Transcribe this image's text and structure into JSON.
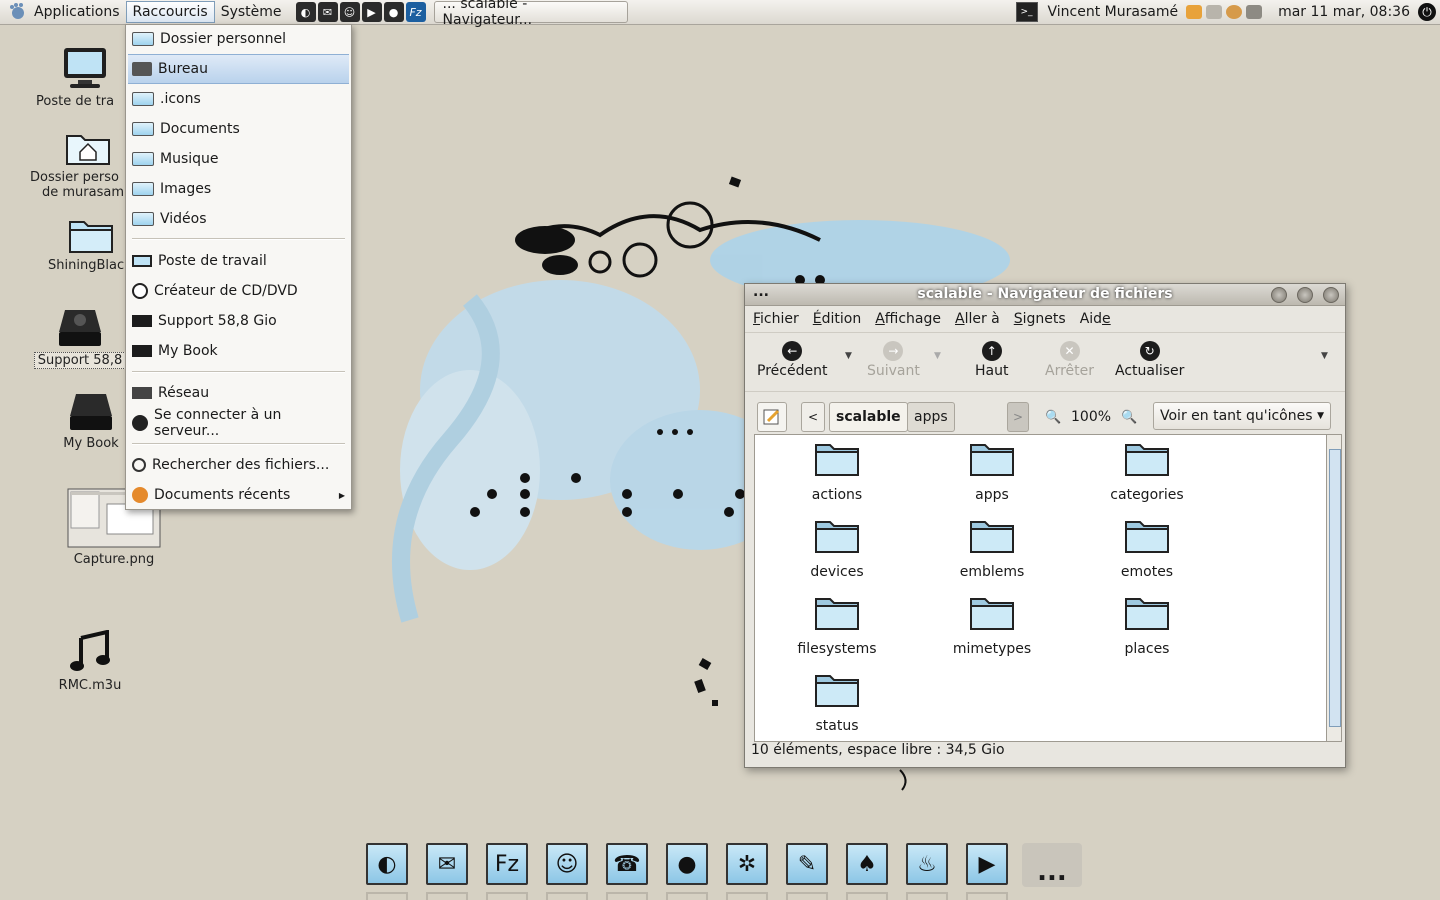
{
  "top_panel": {
    "menus": [
      "Applications",
      "Raccourcis",
      "Système"
    ],
    "task_label": "...  scalable - Navigateur...",
    "user": "Vincent Murasamé",
    "clock": "mar 11 mar, 08:36",
    "launchers": [
      "firefox-icon",
      "mail-icon",
      "people-icon",
      "play-icon",
      "drop-icon",
      "filezilla-icon"
    ],
    "launcher_glyphs": [
      "◐",
      "✉",
      "☺",
      "▶",
      "●",
      "Fz"
    ]
  },
  "places_menu": {
    "items": [
      {
        "label": "Dossier personnel",
        "icon": "home-folder-icon"
      },
      {
        "label": "Bureau",
        "icon": "desktop-folder-icon"
      },
      {
        "label": ".icons",
        "icon": "folder-icon"
      },
      {
        "label": "Documents",
        "icon": "folder-icon"
      },
      {
        "label": "Musique",
        "icon": "folder-icon"
      },
      {
        "label": "Images",
        "icon": "folder-icon"
      },
      {
        "label": "Vidéos",
        "icon": "folder-icon"
      },
      {
        "label": "Poste de travail",
        "icon": "computer-icon"
      },
      {
        "label": "Créateur de CD/DVD",
        "icon": "cd-icon"
      },
      {
        "label": "Support 58,8 Gio",
        "icon": "drive-icon"
      },
      {
        "label": "My Book",
        "icon": "drive-icon"
      },
      {
        "label": "Réseau",
        "icon": "network-icon"
      },
      {
        "label": "Se connecter à un serveur...",
        "icon": "globe-icon"
      },
      {
        "label": "Rechercher des fichiers...",
        "icon": "search-icon"
      },
      {
        "label": "Documents récents",
        "icon": "recent-icon"
      }
    ]
  },
  "desktop": {
    "icons": [
      {
        "label": "Poste de tra",
        "icon": "computer-icon"
      },
      {
        "label": "Dossier perso",
        "label2": "de murasam",
        "icon": "home-folder-icon"
      },
      {
        "label": "ShiningBlac",
        "icon": "folder-icon"
      },
      {
        "label": "Support 58,8",
        "icon": "drive-icon"
      },
      {
        "label": "My Book",
        "icon": "drive-icon"
      },
      {
        "label": "Capture.png",
        "icon": "image-thumbnail-icon"
      },
      {
        "label": "RMC.m3u",
        "icon": "music-note-icon"
      }
    ]
  },
  "window": {
    "title_dots": "...",
    "title": "scalable - Navigateur de fichiers",
    "menubar": [
      {
        "pre": "",
        "u": "F",
        "post": "ichier"
      },
      {
        "pre": "",
        "u": "É",
        "post": "dition"
      },
      {
        "pre": "",
        "u": "A",
        "post": "ffichage"
      },
      {
        "pre": "",
        "u": "A",
        "post": "ller à"
      },
      {
        "pre": "",
        "u": "S",
        "post": "ignets"
      },
      {
        "pre": "Aid",
        "u": "e",
        "post": ""
      }
    ],
    "toolbar": {
      "back": "Précédent",
      "forward": "Suivant",
      "up": "Haut",
      "stop": "Arrêter",
      "reload": "Actualiser"
    },
    "location": {
      "current": "scalable",
      "next": "apps",
      "zoom": "100%",
      "view_mode": "Voir en tant qu'icônes"
    },
    "folders": [
      "actions",
      "apps",
      "categories",
      "devices",
      "emblems",
      "emotes",
      "filesystems",
      "mimetypes",
      "places",
      "status"
    ],
    "status": "10 éléments, espace libre : 34,5 Gio"
  },
  "dock": {
    "items": [
      "firefox-icon",
      "mail-icon",
      "filezilla-icon",
      "people-icon",
      "phone-icon",
      "drop-icon",
      "aperture-icon",
      "gimp-icon",
      "inkscape-icon",
      "flame-icon",
      "play-icon"
    ],
    "glyphs": [
      "◐",
      "✉",
      "Fz",
      "☺",
      "☎",
      "●",
      "✲",
      "✎",
      "♠",
      "♨",
      "▶"
    ],
    "more": "..."
  }
}
